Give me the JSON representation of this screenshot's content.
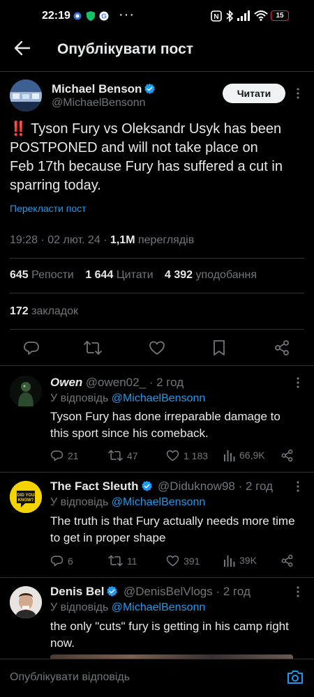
{
  "status_bar": {
    "time": "22:19",
    "dots": "···",
    "battery": "15"
  },
  "header": {
    "title": "Опублікувати пост"
  },
  "post": {
    "author_name": "Michael Benson",
    "author_handle": "@MichaelBensonn",
    "follow_label": "Читати",
    "text_line1": "‼️ Tyson Fury vs Oleksandr Usyk has been",
    "text_line2": "POSTPONED and will not take place on",
    "text_line3": "Feb 17th because Fury has suffered a cut in",
    "text_line4": "sparring today.",
    "translate_label": "Перекласти пост",
    "meta_time": "19:28 · 02 лют. 24 · ",
    "meta_views": "1,1M",
    "meta_views_label": " переглядів",
    "reposts_count": "645",
    "reposts_label": "Репости",
    "quotes_count": "1 644",
    "quotes_label": "Цитати",
    "likes_count": "4 392",
    "likes_label": "уподобання",
    "bookmarks_count": "172",
    "bookmarks_label": "закладок"
  },
  "replies": [
    {
      "name": "Owen",
      "handle": "@owen02_ · 2 год",
      "reply_to_prefix": "У відповідь ",
      "reply_to_handle": "@MichaelBensonn",
      "line1": "Tyson Fury has done irreparable damage to",
      "line2": "this sport since his comeback.",
      "replies": "21",
      "reposts": "47",
      "likes": "1 183",
      "views": "66,9K"
    },
    {
      "name": "The Fact Sleuth",
      "handle": "@Diduknow98 · 2 год",
      "reply_to_prefix": "У відповідь ",
      "reply_to_handle": "@MichaelBensonn",
      "line1": "The truth is that Fury actually needs more time",
      "line2": "to get in proper shape",
      "replies": "6",
      "reposts": "11",
      "likes": "391",
      "views": "39K",
      "avatar_text": "DID YOU KNOW?"
    },
    {
      "name": "Denis Bel",
      "handle": "@DenisBelVlogs · 2 год",
      "reply_to_prefix": "У відповідь ",
      "reply_to_handle": "@MichaelBensonn",
      "line1": "the only \"cuts\" fury is getting in his camp right",
      "line2": "now."
    }
  ],
  "composer": {
    "placeholder": "Опублікувати відповідь"
  },
  "colors": {
    "accent": "#1d9bf0",
    "background": "#000000",
    "text": "#e7e9ea",
    "muted": "#71767b",
    "divider": "#2f3336",
    "badge_gold": "#f5d300"
  }
}
